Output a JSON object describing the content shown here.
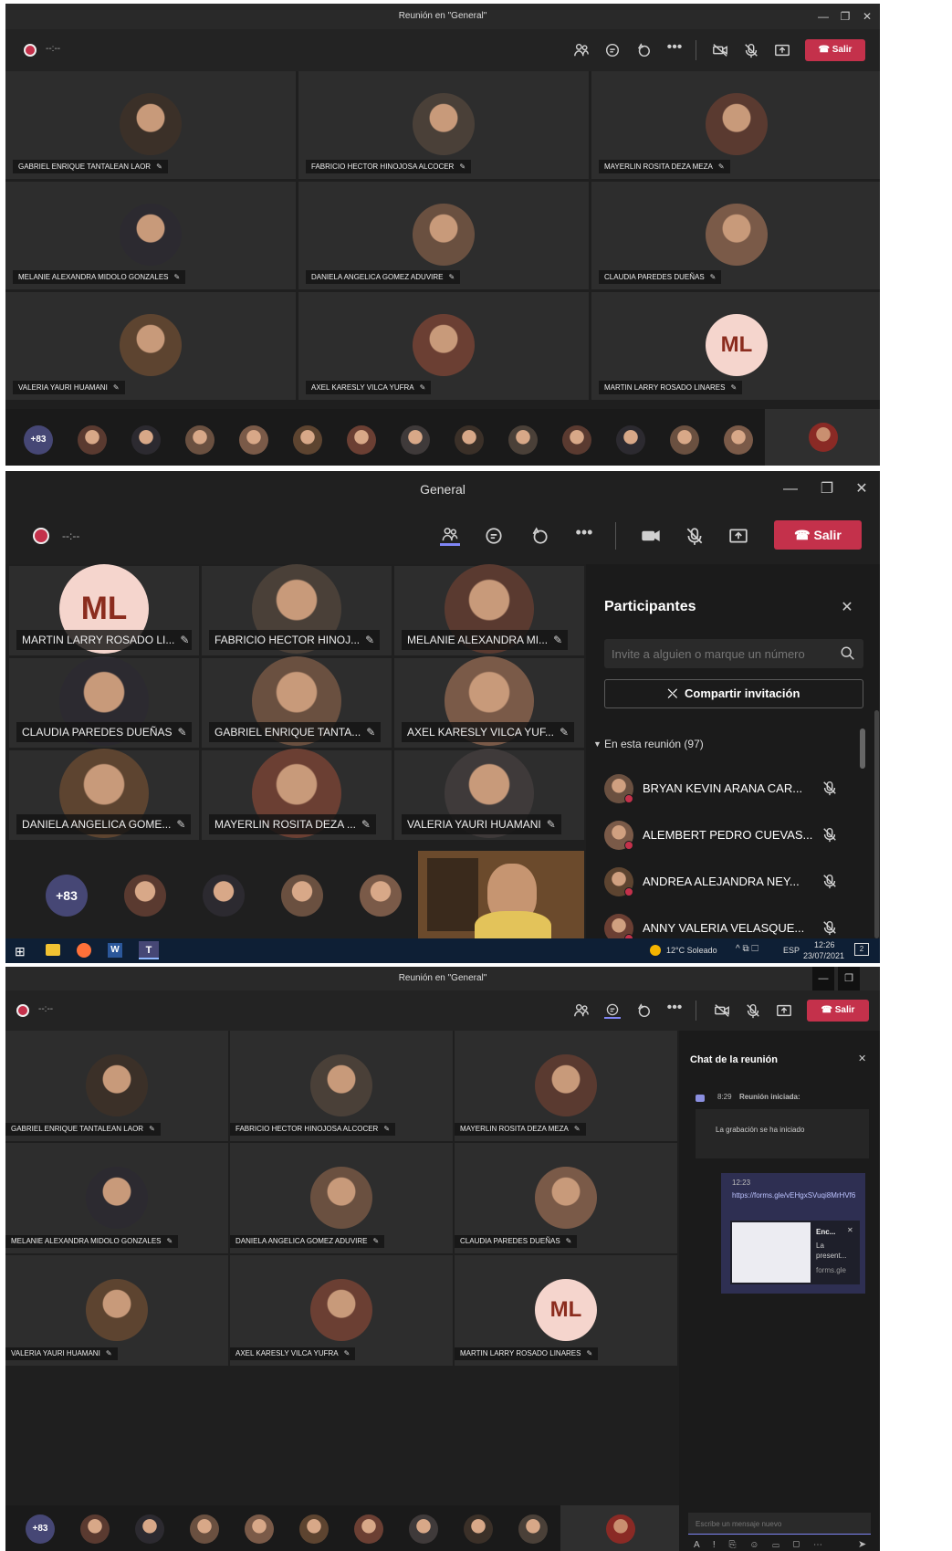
{
  "panel1": {
    "title": "Reunión en \"General\"",
    "timer": "--:--",
    "leave_label": "Salir",
    "tiles": [
      {
        "name": "GABRIEL ENRIQUE TANTALEAN LAOR"
      },
      {
        "name": "FABRICIO HECTOR HINOJOSA ALCOCER"
      },
      {
        "name": "MAYERLIN ROSITA DEZA MEZA"
      },
      {
        "name": "MELANIE ALEXANDRA MIDOLO GONZALES"
      },
      {
        "name": "DANIELA ANGELICA GOMEZ ADUVIRE"
      },
      {
        "name": "CLAUDIA PAREDES DUEÑAS"
      },
      {
        "name": "VALERIA YAURI HUAMANI"
      },
      {
        "name": "AXEL KARESLY VILCA YUFRA"
      },
      {
        "name": "MARTIN LARRY ROSADO LINARES",
        "initials": "ML"
      }
    ],
    "more_count": "+83"
  },
  "panel2": {
    "title": "General",
    "timer": "--:--",
    "leave_label": "Salir",
    "tiles": [
      {
        "name": "MARTIN LARRY ROSADO LI...",
        "initials": "ML"
      },
      {
        "name": "FABRICIO HECTOR HINOJ..."
      },
      {
        "name": "MELANIE ALEXANDRA MI..."
      },
      {
        "name": "CLAUDIA PAREDES DUEÑAS"
      },
      {
        "name": "GABRIEL ENRIQUE TANTA..."
      },
      {
        "name": "AXEL KARESLY VILCA YUF..."
      },
      {
        "name": "DANIELA ANGELICA GOME..."
      },
      {
        "name": "MAYERLIN ROSITA DEZA ..."
      },
      {
        "name": "VALERIA YAURI HUAMANI"
      }
    ],
    "more_count": "+83",
    "participants": {
      "heading": "Participantes",
      "invite_placeholder": "Invite a alguien o marque un número",
      "share_label": "Compartir invitación",
      "section_label": "En esta reunión (97)",
      "list": [
        {
          "name": "BRYAN KEVIN ARANA CAR..."
        },
        {
          "name": "ALEMBERT PEDRO CUEVAS..."
        },
        {
          "name": "ANDREA ALEJANDRA NEY..."
        },
        {
          "name": "ANNY VALERIA VELASQUE..."
        }
      ]
    },
    "taskbar": {
      "weather": "12°C  Soleado",
      "lang": "ESP",
      "time": "12:26",
      "date": "23/07/2021",
      "notif": "2"
    }
  },
  "panel3": {
    "title": "Reunión en \"General\"",
    "timer": "--:--",
    "leave_label": "Salir",
    "tiles": [
      {
        "name": "GABRIEL ENRIQUE TANTALEAN LAOR"
      },
      {
        "name": "FABRICIO HECTOR HINOJOSA ALCOCER"
      },
      {
        "name": "MAYERLIN ROSITA DEZA MEZA"
      },
      {
        "name": "MELANIE ALEXANDRA MIDOLO GONZALES"
      },
      {
        "name": "DANIELA ANGELICA GOMEZ ADUVIRE"
      },
      {
        "name": "CLAUDIA PAREDES DUEÑAS"
      },
      {
        "name": "VALERIA YAURI HUAMANI"
      },
      {
        "name": "AXEL KARESLY VILCA YUFRA"
      },
      {
        "name": "MARTIN LARRY ROSADO LINARES",
        "initials": "ML"
      }
    ],
    "more_count": "+83",
    "chat": {
      "heading": "Chat de la reunión",
      "event_time": "8:29",
      "event_text": "Reunión iniciada:",
      "recording_msg": "La grabación se ha iniciado",
      "msg_time": "12:23",
      "msg_link": "https://forms.gle/vEHgxSVuqi8MrHVf6",
      "card_title": "Enc...",
      "card_line": "La present...",
      "card_domain": "forms.gle",
      "compose_placeholder": "Escribe un mensaje nuevo"
    }
  },
  "colors": {
    "leave_red": "#c4314b",
    "teams_purple": "#464775",
    "stage_bg": "#1f1f1f",
    "tile_bg": "#2d2d2d"
  },
  "icons": [
    "participants-icon",
    "chat-icon",
    "reactions-icon",
    "more-options-icon",
    "camera-off-icon",
    "mic-off-icon",
    "share-tray-icon",
    "phone-hangup-icon",
    "search-icon",
    "share-link-icon",
    "close-icon"
  ]
}
